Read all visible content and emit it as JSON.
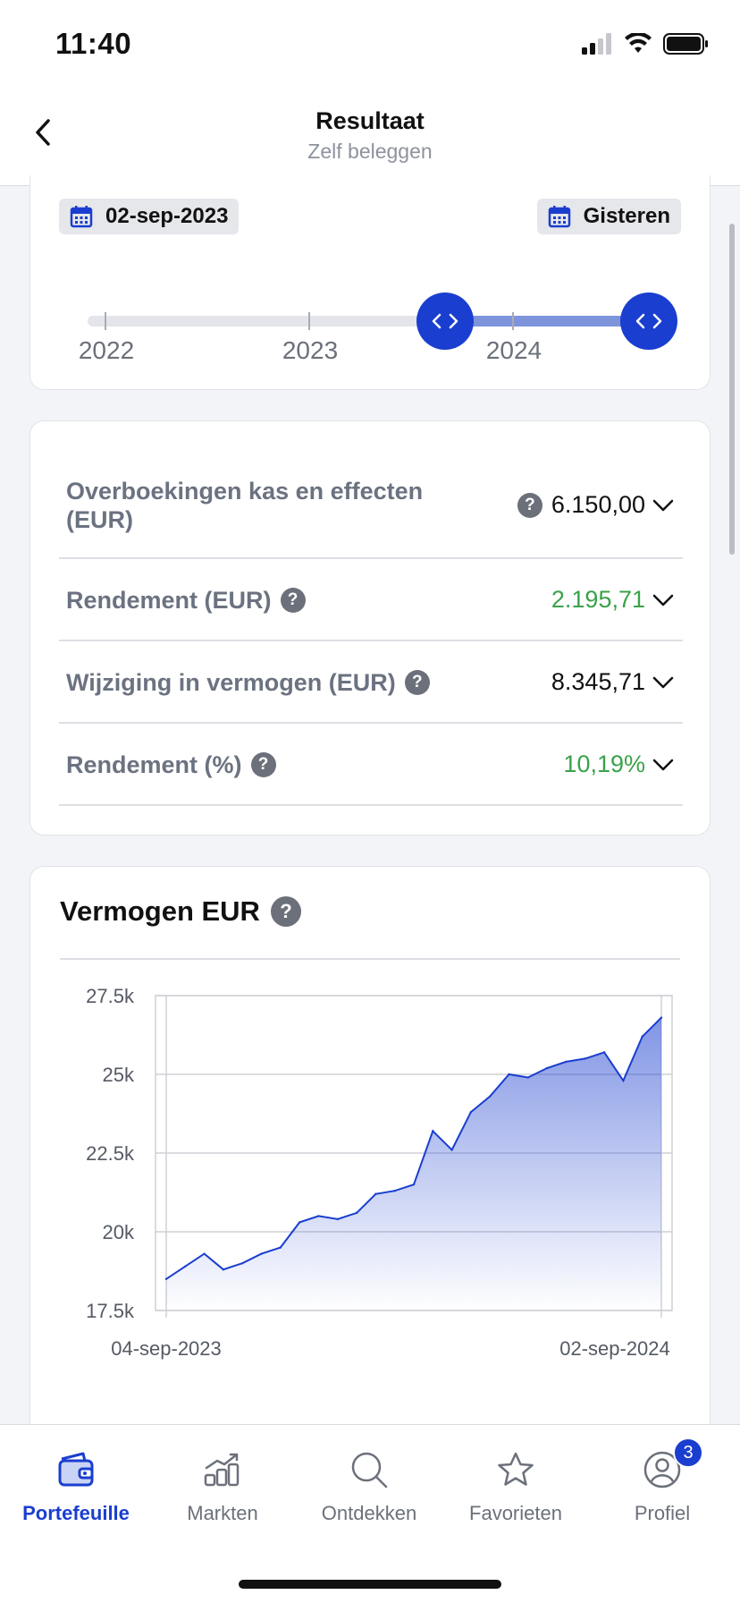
{
  "status_bar": {
    "time": "11:40"
  },
  "header": {
    "title": "Resultaat",
    "subtitle": "Zelf beleggen",
    "back_icon": "chevron-left-icon"
  },
  "range": {
    "start_date": "02-sep-2023",
    "end_date": "Gisteren",
    "years": [
      "2022",
      "2023",
      "2024"
    ],
    "handle_start_fraction": 0.55,
    "handle_end_fraction": 0.9
  },
  "stats": [
    {
      "label": "Overboekingen kas en effecten (EUR)",
      "value": "6.150,00",
      "color": "#111111"
    },
    {
      "label": "Rendement (EUR)",
      "value": "2.195,71",
      "color": "#3aa24a"
    },
    {
      "label": "Wijziging in vermogen (EUR)",
      "value": "8.345,71",
      "color": "#111111"
    },
    {
      "label": "Rendement (%)",
      "value": "10,19%",
      "color": "#3aa24a"
    }
  ],
  "chart_section": {
    "title": "Vermogen EUR"
  },
  "chart_data": {
    "type": "area",
    "title": "Vermogen EUR",
    "xlabel": "",
    "ylabel": "",
    "ylim": [
      17500,
      27500
    ],
    "y_ticks": [
      "27.5k",
      "25k",
      "22.5k",
      "20k",
      "17.5k"
    ],
    "x_tick_labels": [
      "04-sep-2023",
      "02-sep-2024"
    ],
    "x": [
      "2023-09-04",
      "2023-09-18",
      "2023-10-02",
      "2023-10-16",
      "2023-10-30",
      "2023-11-13",
      "2023-11-27",
      "2023-12-11",
      "2023-12-25",
      "2024-01-08",
      "2024-01-22",
      "2024-02-05",
      "2024-02-19",
      "2024-03-04",
      "2024-03-18",
      "2024-04-01",
      "2024-04-15",
      "2024-04-29",
      "2024-05-13",
      "2024-05-27",
      "2024-06-10",
      "2024-06-24",
      "2024-07-08",
      "2024-07-22",
      "2024-08-05",
      "2024-08-19",
      "2024-09-02"
    ],
    "series": [
      {
        "values": [
          18500,
          18900,
          19300,
          18800,
          19000,
          19300,
          19500,
          20300,
          20500,
          20400,
          20600,
          21200,
          21300,
          21500,
          23200,
          22600,
          23800,
          24300,
          25000,
          24900,
          25200,
          25400,
          25500,
          25700,
          24800,
          26200,
          26800
        ],
        "color": "#1a3ecf"
      }
    ],
    "grid": true
  },
  "nav": {
    "items": [
      {
        "label": "Portefeuille",
        "icon": "wallet-icon",
        "active": true
      },
      {
        "label": "Markten",
        "icon": "chart-bars-icon",
        "active": false
      },
      {
        "label": "Ontdekken",
        "icon": "search-icon",
        "active": false
      },
      {
        "label": "Favorieten",
        "icon": "star-icon",
        "active": false
      },
      {
        "label": "Profiel",
        "icon": "profile-icon",
        "active": false,
        "badge": "3"
      }
    ]
  }
}
